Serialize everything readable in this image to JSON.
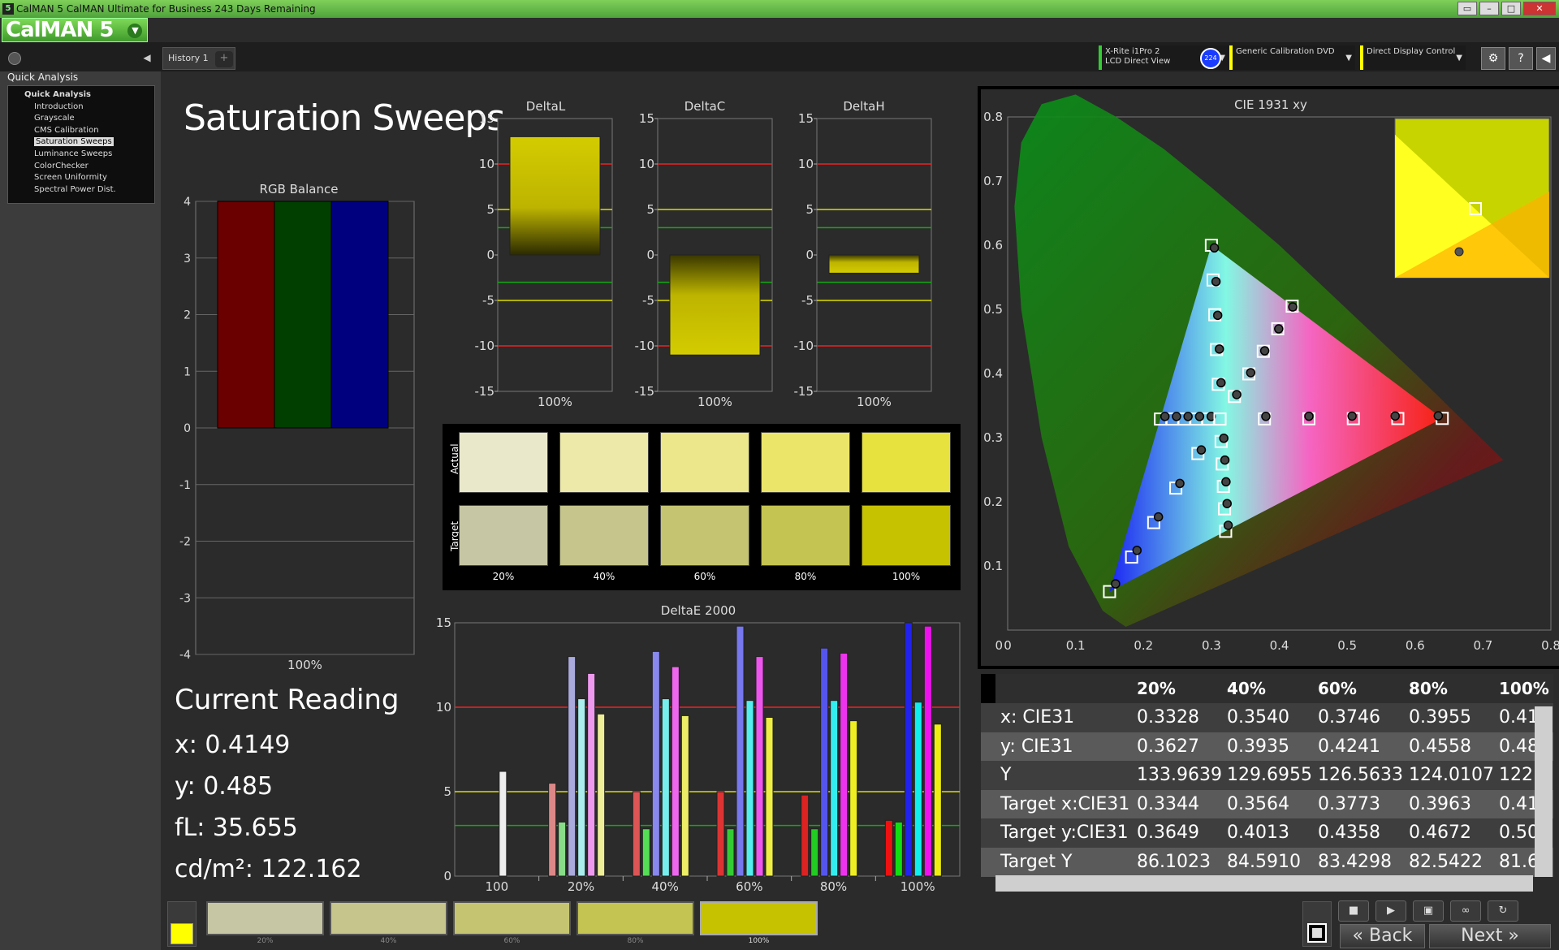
{
  "window": {
    "title": "CalMAN 5 CalMAN Ultimate for Business 243 Days Remaining",
    "logo": "CalMAN 5"
  },
  "tabs": [
    {
      "label": "History 1"
    }
  ],
  "sidebar": {
    "header": "Quick Analysis",
    "items": [
      {
        "label": "Quick Analysis"
      },
      {
        "label": "Introduction"
      },
      {
        "label": "Grayscale"
      },
      {
        "label": "CMS Calibration"
      },
      {
        "label": "Saturation Sweeps"
      },
      {
        "label": "Luminance Sweeps"
      },
      {
        "label": "ColorChecker"
      },
      {
        "label": "Screen Uniformity"
      },
      {
        "label": "Spectral Power Dist."
      }
    ]
  },
  "devices": {
    "meter_line1": "X-Rite i1Pro 2",
    "meter_line2": "LCD Direct View",
    "badge": "224",
    "source": "Generic Calibration DVD",
    "display": "Direct Display Control"
  },
  "page": {
    "title": "Saturation Sweeps"
  },
  "current_reading": {
    "title": "Current Reading",
    "x": "x: 0.4149",
    "y": "y: 0.485",
    "fl": "fL: 35.655",
    "cdm2": "cd/m²: 122.162"
  },
  "chart_data": [
    {
      "type": "bar",
      "title": "RGB Balance",
      "categories": [
        "100%"
      ],
      "series": [
        {
          "values": [
            4
          ]
        },
        {
          "values": [
            4
          ]
        },
        {
          "values": [
            4
          ]
        }
      ],
      "ylim": [
        -4,
        4
      ],
      "colors": [
        "#6a0000",
        "#003f00",
        "#00007e"
      ]
    },
    {
      "type": "bar",
      "title": "DeltaL",
      "categories": [
        "100%"
      ],
      "values": [
        13
      ],
      "ylim": [
        -15,
        15
      ]
    },
    {
      "type": "bar",
      "title": "DeltaC",
      "categories": [
        "100%"
      ],
      "values": [
        -11
      ],
      "ylim": [
        -15,
        15
      ]
    },
    {
      "type": "bar",
      "title": "DeltaH",
      "categories": [
        "100%"
      ],
      "values": [
        -2
      ],
      "ylim": [
        -15,
        15
      ]
    },
    {
      "type": "bar",
      "title": "DeltaE 2000",
      "categories": [
        "100",
        "20%",
        "40%",
        "60%",
        "80%",
        "100%"
      ],
      "ylim": [
        0,
        15
      ]
    },
    {
      "type": "scatter",
      "title": "CIE 1931 xy",
      "xlim": [
        0,
        0.8
      ],
      "ylim": [
        0,
        0.8
      ]
    }
  ],
  "swatches": {
    "actual_label": "Actual",
    "target_label": "Target",
    "labels": [
      "20%",
      "40%",
      "60%",
      "80%",
      "100%"
    ],
    "actual": [
      "#eae8cb",
      "#ece9a9",
      "#ece78a",
      "#ebe56a",
      "#e8e23e"
    ],
    "target": [
      "#c6c6a5",
      "#c5c58c",
      "#c5c571",
      "#c4c452",
      "#c6c200"
    ]
  },
  "table": {
    "columns": [
      "20%",
      "40%",
      "60%",
      "80%",
      "100%"
    ],
    "rows": [
      {
        "label": "x: CIE31",
        "values": [
          "0.3328",
          "0.3540",
          "0.3746",
          "0.3955",
          "0.41"
        ]
      },
      {
        "label": "y: CIE31",
        "values": [
          "0.3627",
          "0.3935",
          "0.4241",
          "0.4558",
          "0.48"
        ]
      },
      {
        "label": "Y",
        "values": [
          "133.9639",
          "129.6955",
          "126.5633",
          "124.0107",
          "122"
        ]
      },
      {
        "label": "Target x:CIE31",
        "values": [
          "0.3344",
          "0.3564",
          "0.3773",
          "0.3963",
          "0.41"
        ]
      },
      {
        "label": "Target y:CIE31",
        "values": [
          "0.3649",
          "0.4013",
          "0.4358",
          "0.4672",
          "0.50"
        ]
      },
      {
        "label": "Target Y",
        "values": [
          "86.1023",
          "84.5910",
          "83.4298",
          "82.5422",
          "81.6"
        ]
      }
    ]
  },
  "bottom": {
    "swatch_labels": [
      "20%",
      "40%",
      "60%",
      "80%",
      "100%"
    ],
    "back": "Back",
    "next": "Next"
  }
}
